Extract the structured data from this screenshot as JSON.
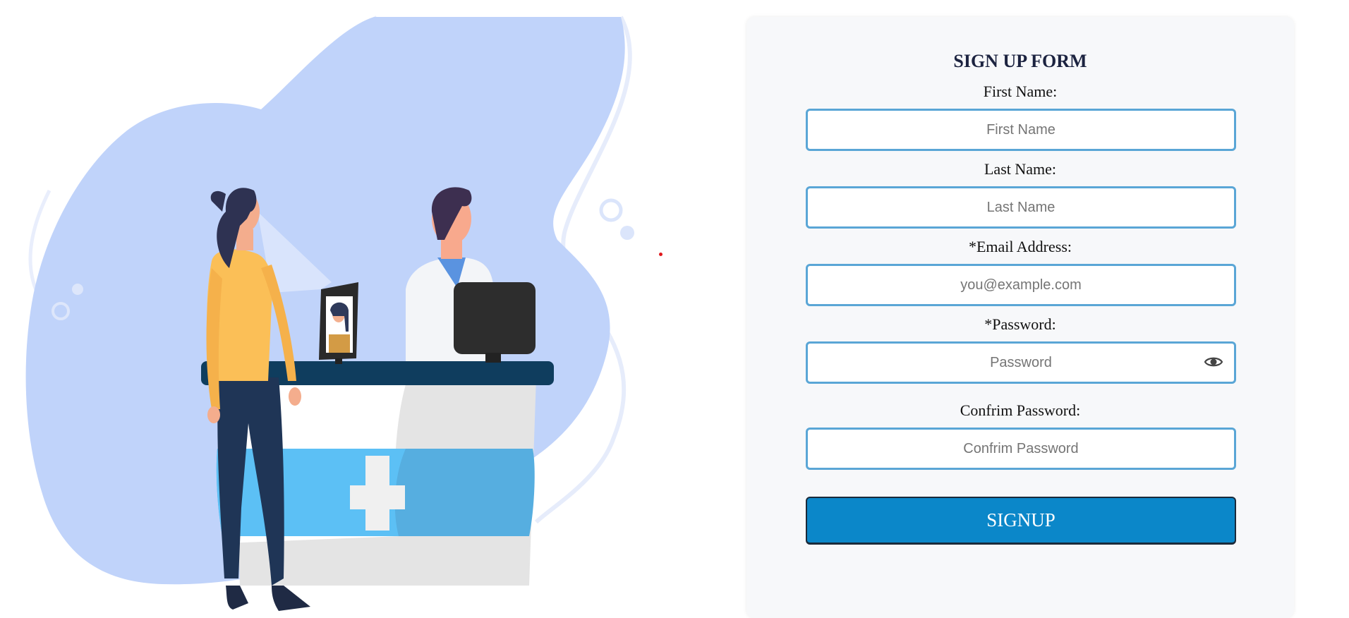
{
  "form": {
    "title": "SIGN UP FORM",
    "first_name": {
      "label": "First Name:",
      "placeholder": "First Name",
      "value": ""
    },
    "last_name": {
      "label": "Last Name:",
      "placeholder": "Last Name",
      "value": ""
    },
    "email": {
      "label": "*Email Address:",
      "placeholder": "you@example.com",
      "value": ""
    },
    "password": {
      "label": "*Password:",
      "placeholder": "Password",
      "value": "",
      "toggle_icon": "eye-icon"
    },
    "confirm_password": {
      "label": "Confrim Password:",
      "placeholder": "Confrim Password",
      "value": ""
    },
    "submit_label": "SIGNUP"
  },
  "colors": {
    "accent": "#0b87c9",
    "input_border": "#5aa6d6",
    "card_bg": "#f7f8fa",
    "blob": "#c0d3fa",
    "title": "#1c2340"
  },
  "illustration": {
    "icon": "pharmacy-counter-illustration"
  }
}
